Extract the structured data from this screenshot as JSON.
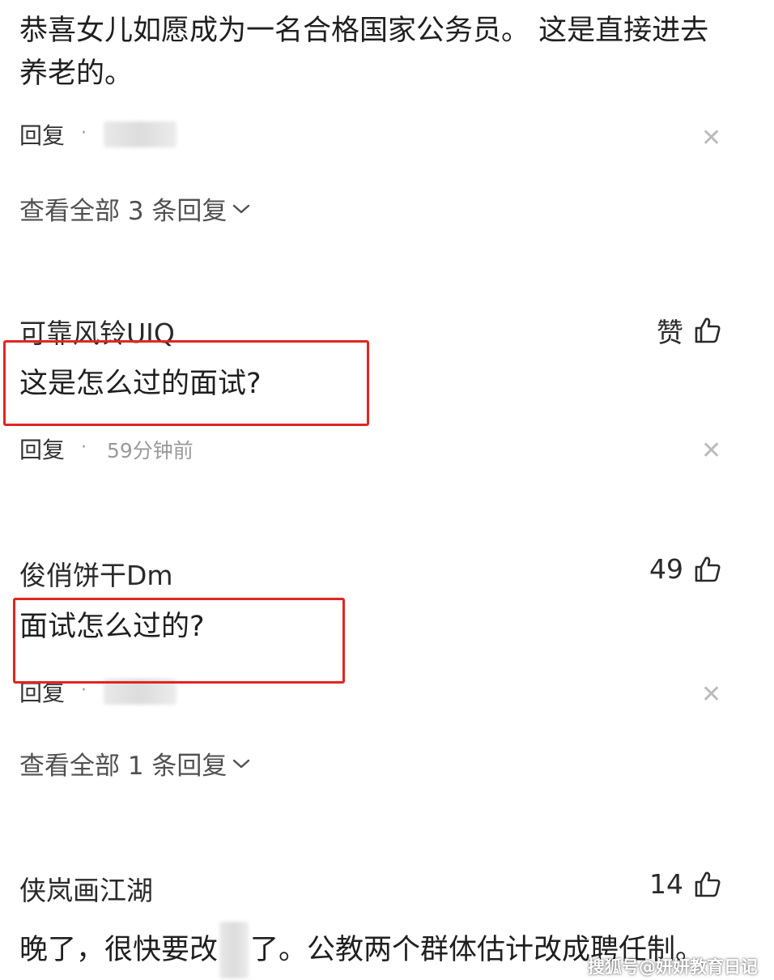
{
  "comments": [
    {
      "content_line1": "恭喜女儿如愿成为一名合格国家公务员。 这是直接进去",
      "content_line2": "养老的。",
      "reply_label": "回复",
      "dot": "·",
      "view_all": "查看全部 3 条回复"
    },
    {
      "username": "可靠风铃UIQ",
      "like_label": "赞",
      "content": "这是怎么过的面试?",
      "reply_label": "回复",
      "dot": "·",
      "timestamp": "59分钟前"
    },
    {
      "username": "俊俏饼干Dm",
      "like_label": "49",
      "content": "面试怎么过的?",
      "reply_label": "回复",
      "dot": "·",
      "view_all": "查看全部 1 条回复"
    },
    {
      "username": "侠岚画江湖",
      "like_label": "14",
      "content_before": "晚了，很快要改",
      "content_after": "了。公教两个群体估计改成聘任制。"
    }
  ],
  "watermark": "搜狐号@妍妍教育日记",
  "colors": {
    "highlight_border": "#e0261f",
    "muted_text": "#9a9a9a"
  },
  "icons": {
    "like": "thumbs-up-icon",
    "close": "close-icon",
    "expand": "chevron-down-icon"
  }
}
